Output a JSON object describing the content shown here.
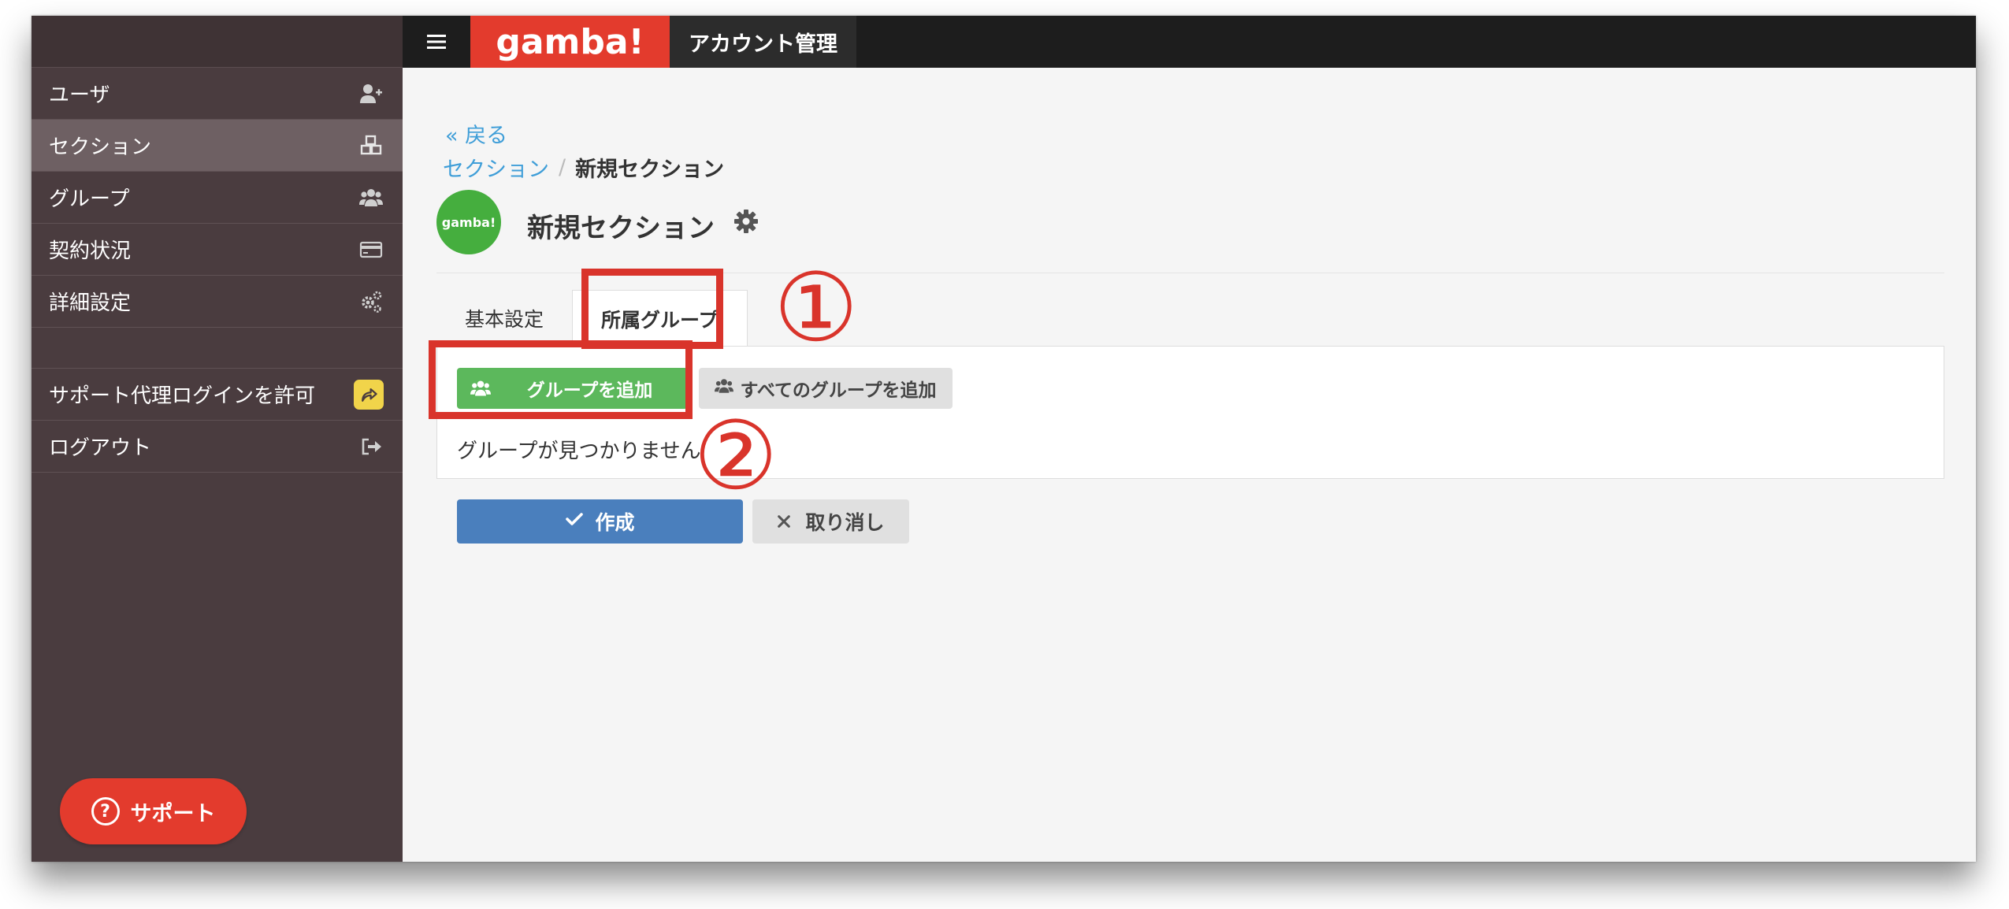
{
  "topbar": {
    "menu_icon": "hamburger-icon",
    "brand": "gamba!",
    "title": "アカウント管理"
  },
  "sidebar": {
    "items": [
      {
        "label": "ユーザ",
        "icon": "user-plus-icon"
      },
      {
        "label": "セクション",
        "icon": "cubes-icon",
        "active": true
      },
      {
        "label": "グループ",
        "icon": "users-icon"
      },
      {
        "label": "契約状況",
        "icon": "credit-card-icon"
      },
      {
        "label": "詳細設定",
        "icon": "gears-icon"
      },
      {
        "label": "サポート代理ログインを許可",
        "icon": "share-icon"
      },
      {
        "label": "ログアウト",
        "icon": "sign-out-icon"
      }
    ],
    "support_button": "サポート"
  },
  "main": {
    "back": "« 戻る",
    "breadcrumb": {
      "parent": "セクション",
      "separator": "/",
      "current": "新規セクション"
    },
    "logo_text": "gamba!",
    "title": "新規セクション",
    "tabs": [
      {
        "label": "基本設定"
      },
      {
        "label": "所属グループ",
        "active": true
      }
    ],
    "add_group_button": "グループを追加",
    "add_all_groups_button": "すべてのグループを追加",
    "empty_message": "グループが見つかりません",
    "create_button": "作成",
    "cancel_button": "取り消し"
  },
  "annotations": {
    "callout_1": "①",
    "callout_2": "②",
    "color": "#d9342b"
  },
  "colors": {
    "brand_red": "#e33b2d",
    "sidebar_bg": "#4a3c3f",
    "link_blue": "#3f9ed8",
    "primary_blue": "#4a7fbd",
    "success_green": "#5cb85c"
  }
}
